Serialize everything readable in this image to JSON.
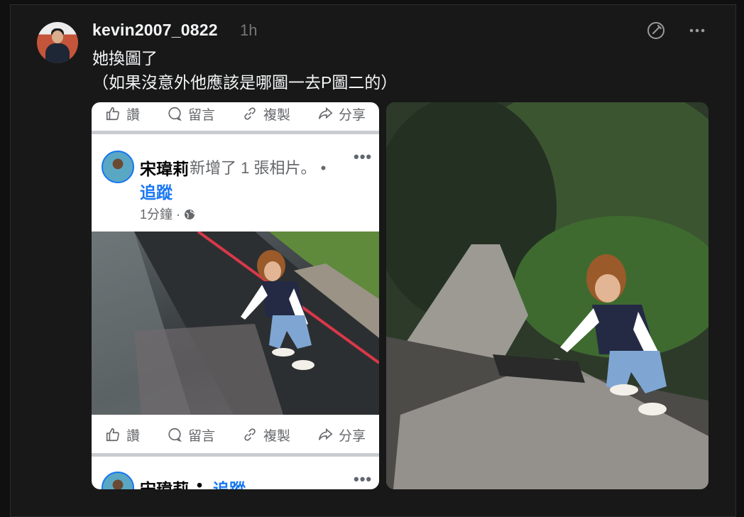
{
  "post": {
    "username": "kevin2007_0822",
    "time": "1h",
    "caption_line1": "她換圖了",
    "caption_line2": "（如果沒意外他應該是哪圖一去P圖二的）",
    "icons": {
      "edit": "edit-circle-icon",
      "more": "more-horizontal-icon"
    }
  },
  "fb_screenshot": {
    "actions": {
      "like": "讚",
      "comment": "留言",
      "copy": "複製",
      "share": "分享"
    },
    "post1": {
      "author": "宋瑋莉",
      "activity": "新增了 1 張相片。 •",
      "follow": "追蹤",
      "timestamp": "1分鐘 ·"
    },
    "post2": {
      "author": "宋瑋莉",
      "separator": "•",
      "follow": "追蹤"
    },
    "more_dots": "•••"
  },
  "colors": {
    "background": "#101010",
    "panel": "#181818",
    "facebook_blue": "#1877f2",
    "muted": "#777777"
  }
}
